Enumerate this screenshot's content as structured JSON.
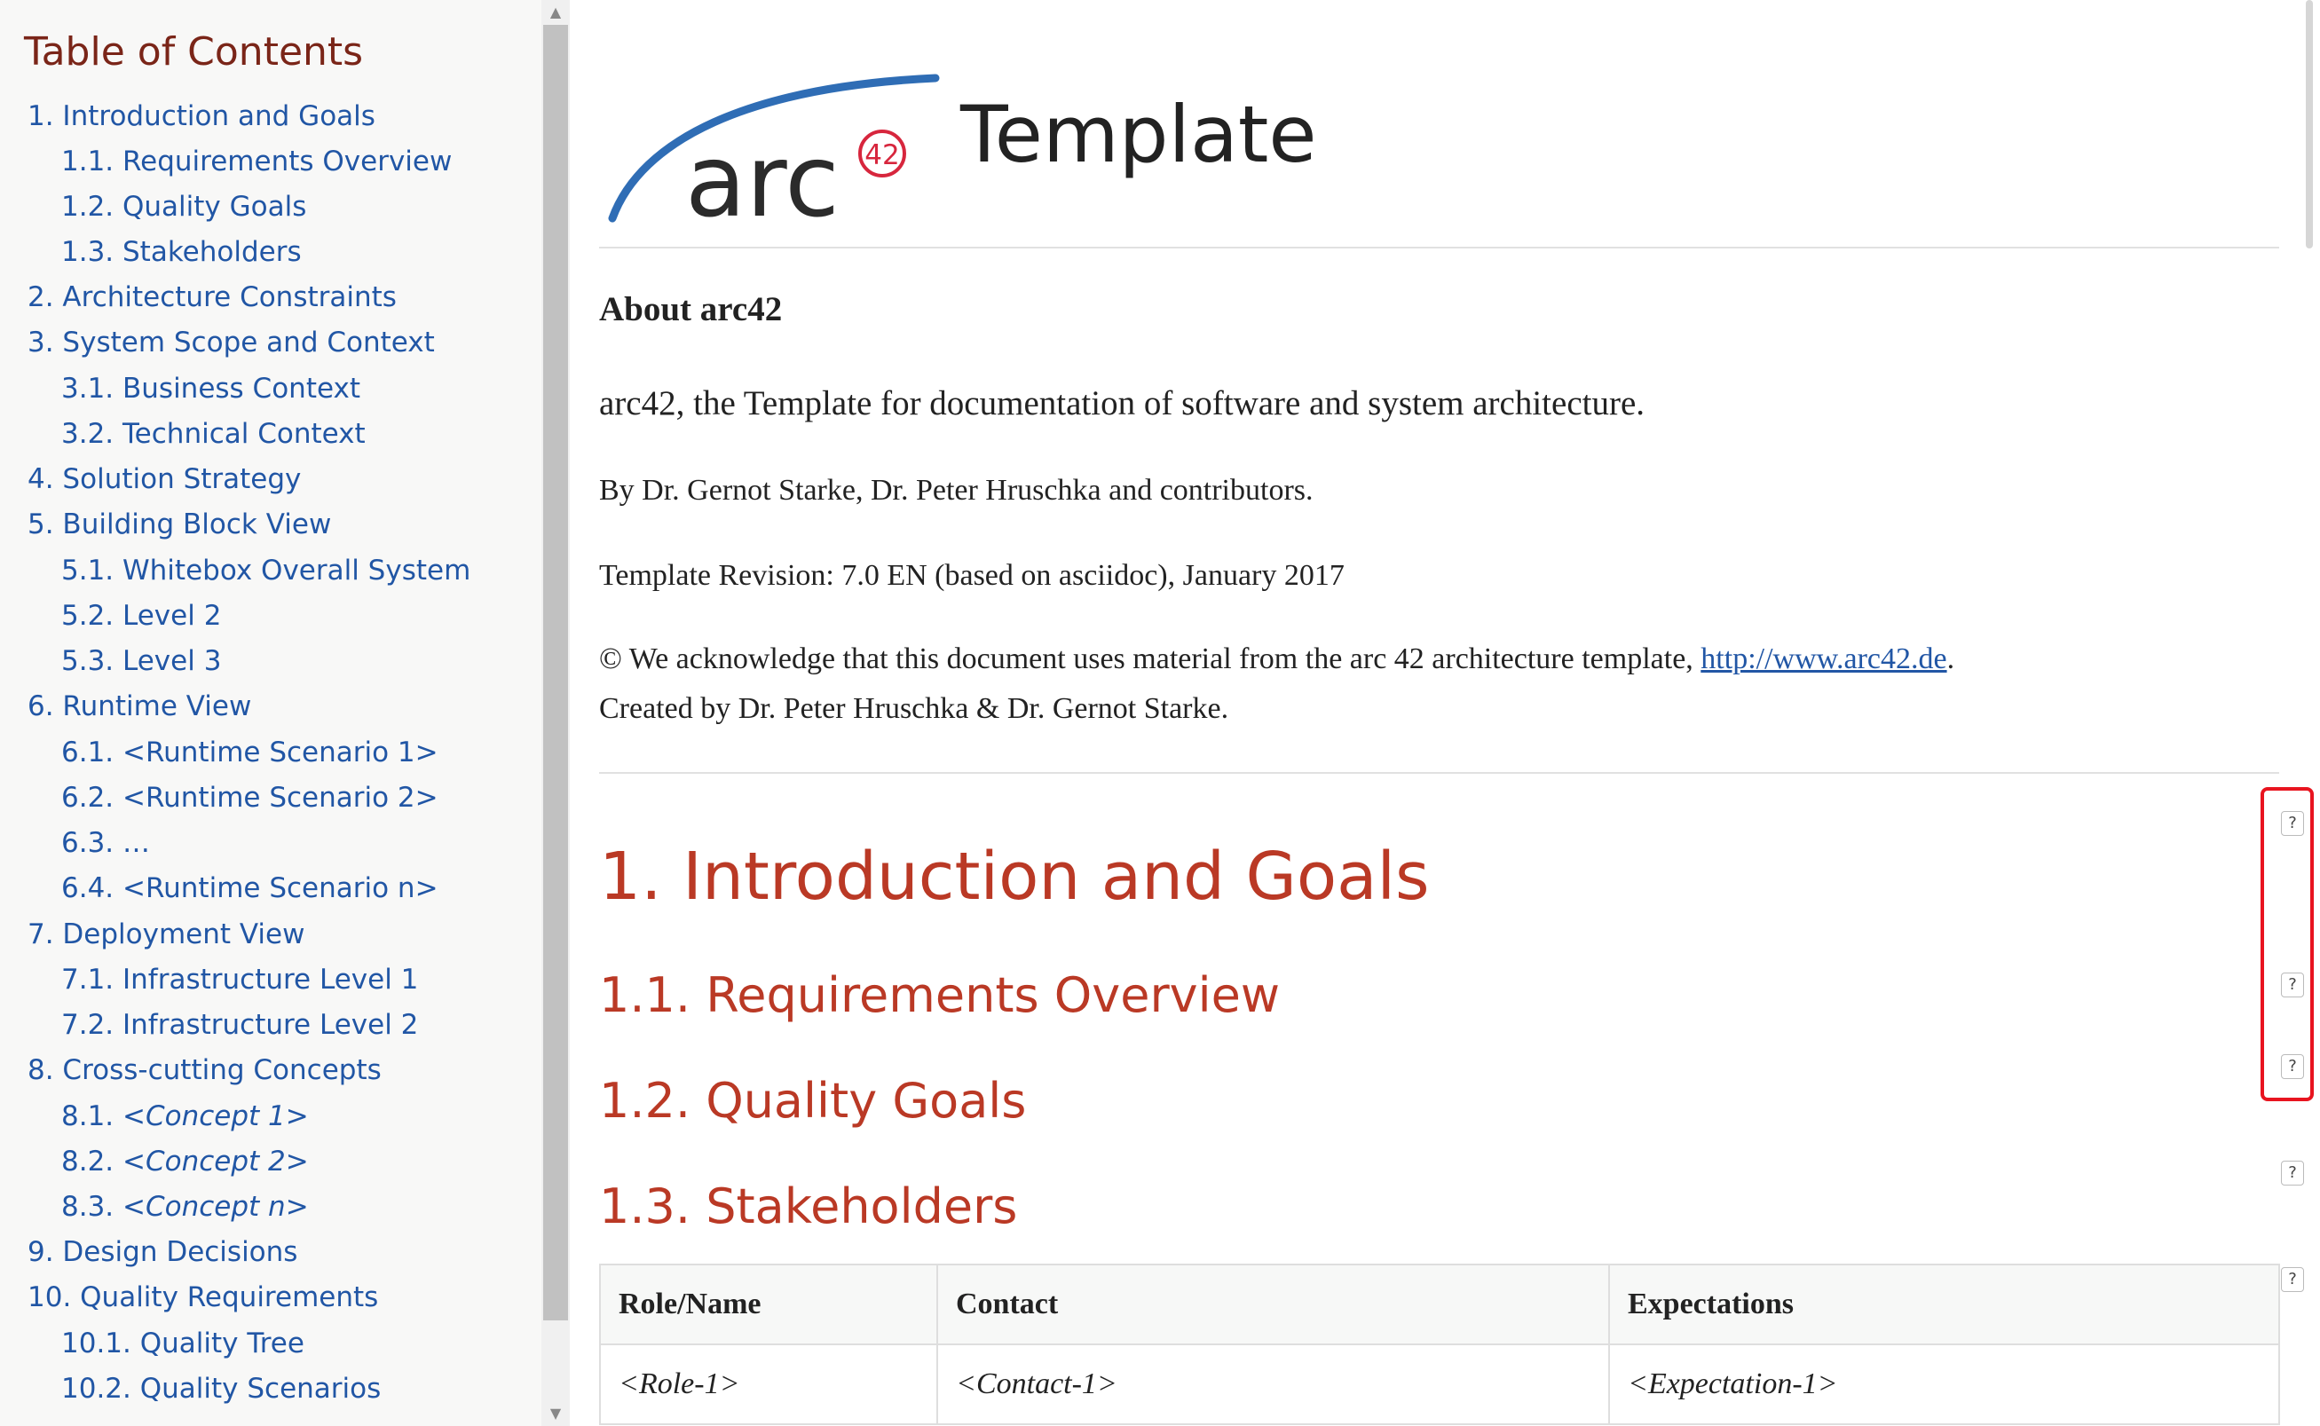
{
  "toc": {
    "title": "Table of Contents",
    "items": [
      {
        "label": "1. Introduction and Goals"
      },
      {
        "label": "1.1. Requirements Overview"
      },
      {
        "label": "1.2. Quality Goals"
      },
      {
        "label": "1.3. Stakeholders"
      },
      {
        "label": "2. Architecture Constraints"
      },
      {
        "label": "3. System Scope and Context"
      },
      {
        "label": "3.1. Business Context"
      },
      {
        "label": "3.2. Technical Context"
      },
      {
        "label": "4. Solution Strategy"
      },
      {
        "label": "5. Building Block View"
      },
      {
        "label": "5.1. Whitebox Overall System"
      },
      {
        "label": "5.2. Level 2"
      },
      {
        "label": "5.3. Level 3"
      },
      {
        "label": "6. Runtime View"
      },
      {
        "label": "6.1. <Runtime Scenario 1>"
      },
      {
        "label": "6.2. <Runtime Scenario 2>"
      },
      {
        "label": "6.3. …"
      },
      {
        "label": "6.4. <Runtime Scenario n>"
      },
      {
        "label": "7. Deployment View"
      },
      {
        "label": "7.1. Infrastructure Level 1"
      },
      {
        "label": "7.2. Infrastructure Level 2"
      },
      {
        "label": "8. Cross-cutting Concepts"
      },
      {
        "label": "8.1. ",
        "italic": "<Concept 1>"
      },
      {
        "label": "8.2. ",
        "italic": "<Concept 2>"
      },
      {
        "label": "8.3. ",
        "italic": "<Concept n>"
      },
      {
        "label": "9. Design Decisions"
      },
      {
        "label": "10. Quality Requirements"
      },
      {
        "label": "10.1. Quality Tree"
      },
      {
        "label": "10.2. Quality Scenarios"
      }
    ]
  },
  "header": {
    "logo_text": "arc",
    "logo_badge": "42",
    "title": "Template"
  },
  "about": {
    "heading": "About arc42",
    "lead": "arc42, the Template for documentation of software and system architecture.",
    "authors": "By Dr. Gernot Starke, Dr. Peter Hruschka and contributors.",
    "revision": "Template Revision: 7.0 EN (based on asciidoc), January 2017",
    "ack_prefix": "© We acknowledge that this document uses material from the arc 42 architecture template, ",
    "ack_link": "http://www.arc42.de",
    "ack_suffix": ".",
    "ack_line2": "Created by Dr. Peter Hruschka & Dr. Gernot Starke."
  },
  "sections": {
    "intro": "1. Introduction and Goals",
    "requirements": "1.1. Requirements Overview",
    "quality_goals": "1.2. Quality Goals",
    "stakeholders": "1.3. Stakeholders"
  },
  "help_marker": "?",
  "stakeholder_table": {
    "headers": [
      "Role/Name",
      "Contact",
      "Expectations"
    ],
    "rows": [
      [
        "<Role-1>",
        "<Contact-1>",
        "<Expectation-1>"
      ]
    ]
  },
  "colors": {
    "link": "#2156a5",
    "section_heading": "#ba3925",
    "toc_title": "#7a2518",
    "highlight": "#e8141f"
  }
}
